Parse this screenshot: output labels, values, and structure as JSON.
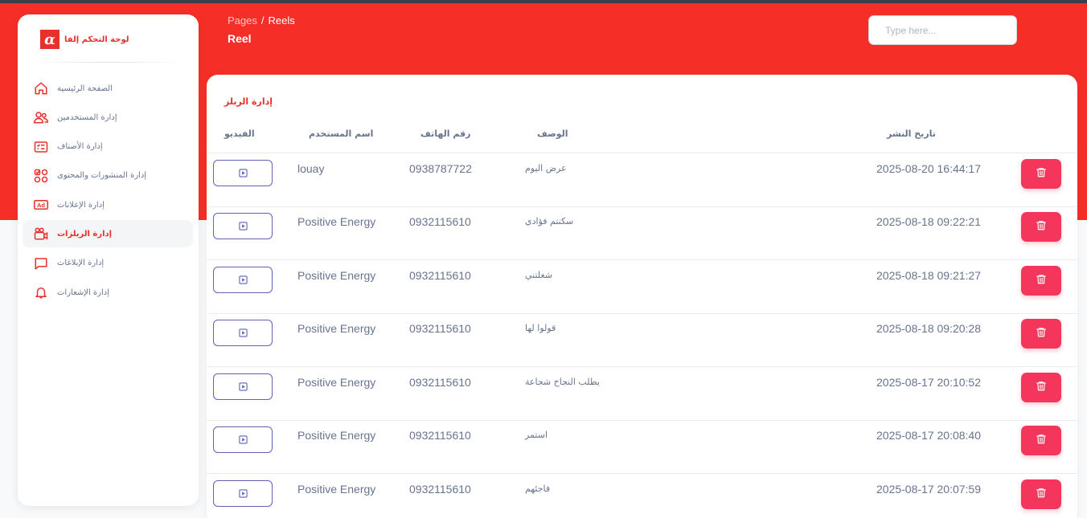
{
  "brand": {
    "logo_glyph": "α",
    "name": "لوحة التحكم إلفا"
  },
  "sidebar": {
    "items": [
      {
        "label": "الصفحة الرئيسية",
        "icon": "home-icon",
        "active": false
      },
      {
        "label": "إدارة المستخدمين",
        "icon": "users-icon",
        "active": false
      },
      {
        "label": "إدارة الأصناف",
        "icon": "list-icon",
        "active": false
      },
      {
        "label": "إدارة المنشورات والمحتوى",
        "icon": "grid-check-icon",
        "active": false
      },
      {
        "label": "إدارة الإعلانات",
        "icon": "ad-icon",
        "active": false
      },
      {
        "label": "إدارة الريلزات",
        "icon": "video-camera-icon",
        "active": true
      },
      {
        "label": "إدارة الإبلاغات",
        "icon": "message-icon",
        "active": false
      },
      {
        "label": "إدارة الإشعارات",
        "icon": "bell-icon",
        "active": false
      }
    ]
  },
  "header": {
    "breadcrumb_parent": "Pages",
    "breadcrumb_separator": "/",
    "breadcrumb_current": "Reels",
    "title": "Reel",
    "search_placeholder": "Type here..."
  },
  "card": {
    "title": "إدارة الريلز",
    "columns": {
      "video": "الفيديو",
      "username": "اسم المستخدم",
      "phone": "رقم الهاتف",
      "description": "الوصف",
      "date": "تاريخ النشر"
    },
    "rows": [
      {
        "username": "louay",
        "phone": "0938787722",
        "description": "عرض اليوم",
        "date": "2025-08-20 16:44:17"
      },
      {
        "username": "Positive Energy",
        "phone": "0932115610",
        "description": "سكنتم فؤادي",
        "date": "2025-08-18 09:22:21"
      },
      {
        "username": "Positive Energy",
        "phone": "0932115610",
        "description": "شغلتني",
        "date": "2025-08-18 09:21:27"
      },
      {
        "username": "Positive Energy",
        "phone": "0932115610",
        "description": "قولوا لها",
        "date": "2025-08-18 09:20:28"
      },
      {
        "username": "Positive Energy",
        "phone": "0932115610",
        "description": "يطلب النجاح شجاعة",
        "date": "2025-08-17 20:10:52"
      },
      {
        "username": "Positive Energy",
        "phone": "0932115610",
        "description": "استمر",
        "date": "2025-08-17 20:08:40"
      },
      {
        "username": "Positive Energy",
        "phone": "0932115610",
        "description": "فاجئهم",
        "date": "2025-08-17 20:07:59"
      }
    ]
  },
  "colors": {
    "primary": "#f52f27",
    "danger": "#f5365c",
    "video_button_border": "#5e63b8",
    "text_muted": "#67748e"
  }
}
